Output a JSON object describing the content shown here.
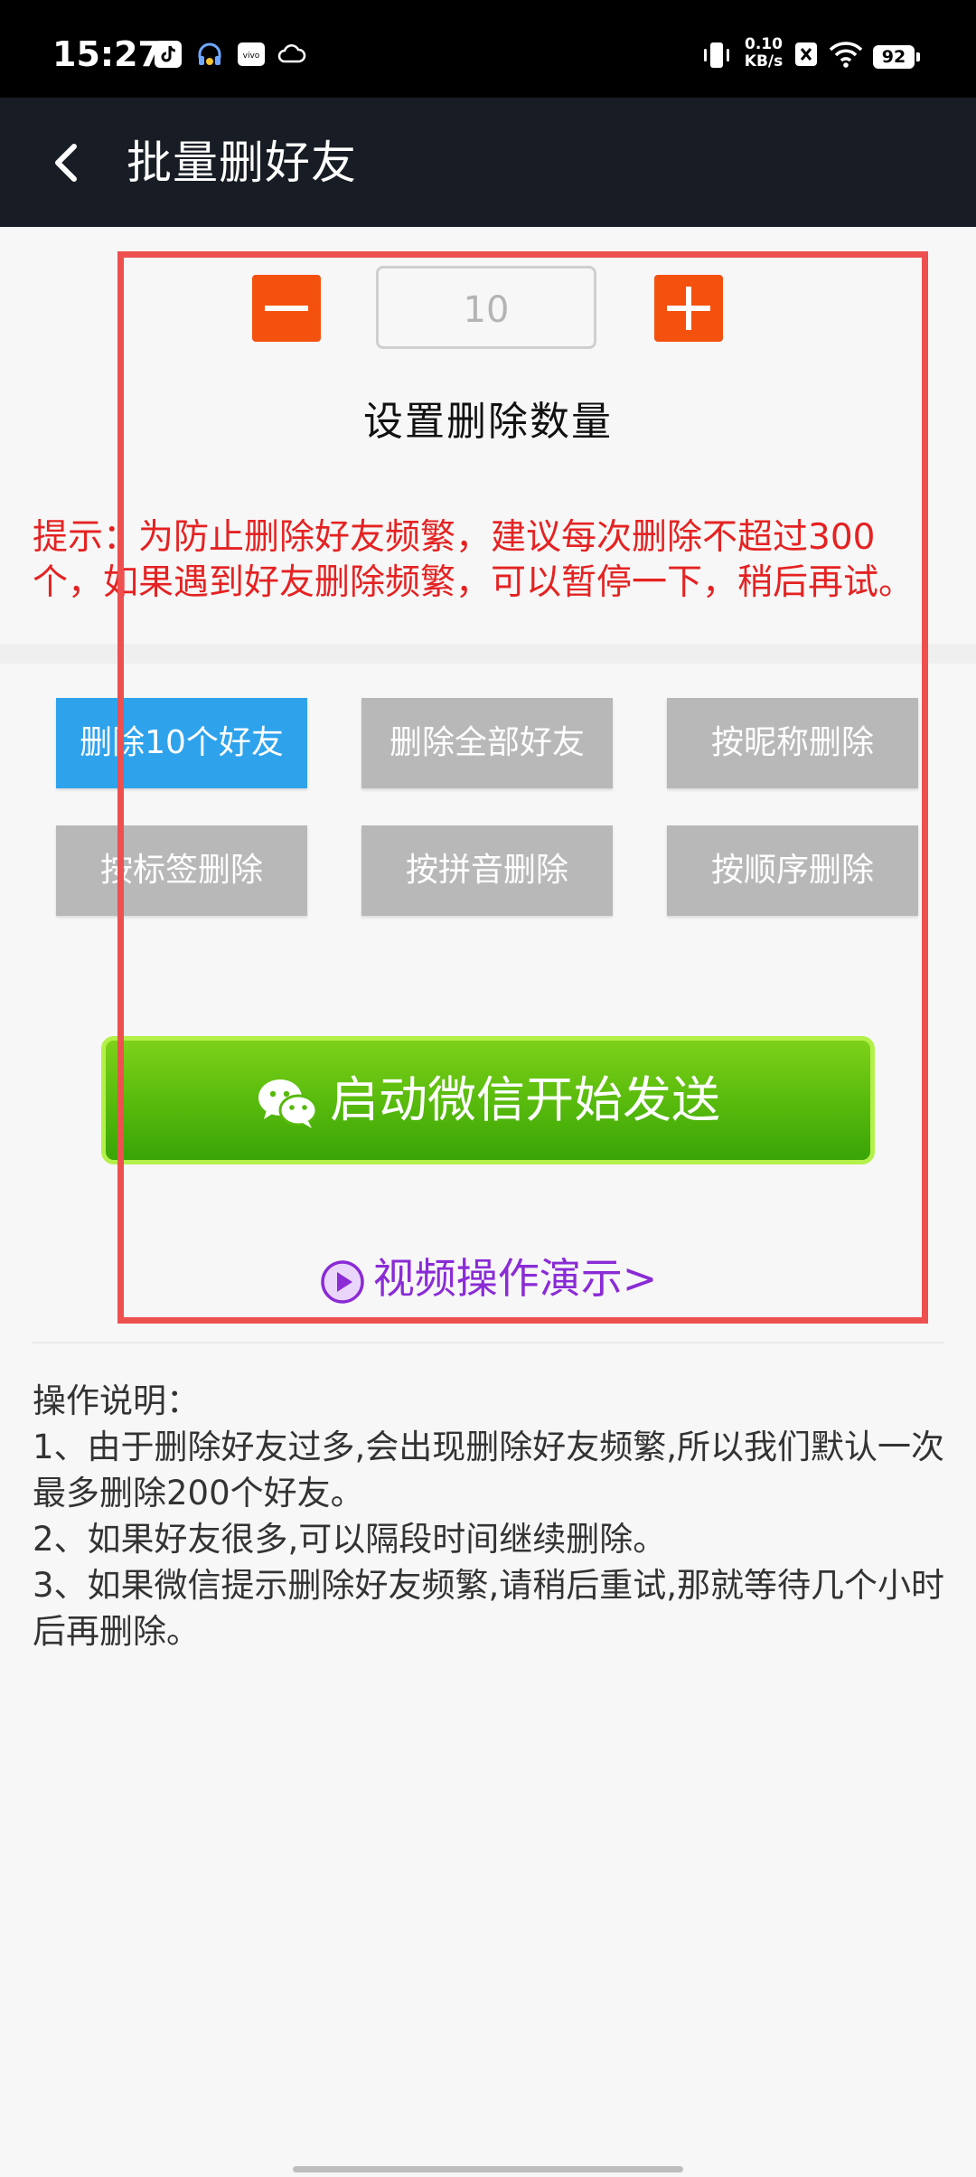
{
  "status_bar": {
    "time": "15:27",
    "net_speed_value": "0.10",
    "net_speed_unit": "KB/s",
    "battery": "92",
    "icons": [
      "tiktok-icon",
      "headphone-icon",
      "vivo-icon",
      "cloud-icon",
      "vibrate-icon",
      "sim-x-icon",
      "wifi-icon",
      "battery-icon"
    ]
  },
  "app_bar": {
    "title": "批量删好友"
  },
  "quantity": {
    "value": "10",
    "label": "设置删除数量"
  },
  "hint": {
    "text": "提示：为防止删除好友频繁，建议每次删除不超过300个，如果遇到好友删除频繁，可以暂停一下，稍后再试。"
  },
  "options": [
    {
      "label": "删除10个好友",
      "active": true
    },
    {
      "label": "删除全部好友",
      "active": false
    },
    {
      "label": "按昵称删除",
      "active": false
    },
    {
      "label": "按标签删除",
      "active": false
    },
    {
      "label": "按拼音删除",
      "active": false
    },
    {
      "label": "按顺序删除",
      "active": false
    }
  ],
  "start_button": {
    "label": "启动微信开始发送"
  },
  "video_link": {
    "label": "视频操作演示>"
  },
  "instructions": {
    "title": "操作说明：",
    "items": [
      "1、由于删除好友过多,会出现删除好友频繁,所以我们默认一次最多删除200个好友。",
      "2、如果好友很多,可以隔段时间继续删除。",
      "3、如果微信提示删除好友频繁,请稍后重试,那就等待几个小时后再删除。"
    ]
  },
  "colors": {
    "accent_orange": "#f4510e",
    "hint_red": "#e52222",
    "active_blue": "#2ea3ec",
    "start_green": "#56b90c",
    "link_purple": "#8a2bd6",
    "highlight_red": "#ee5050"
  }
}
